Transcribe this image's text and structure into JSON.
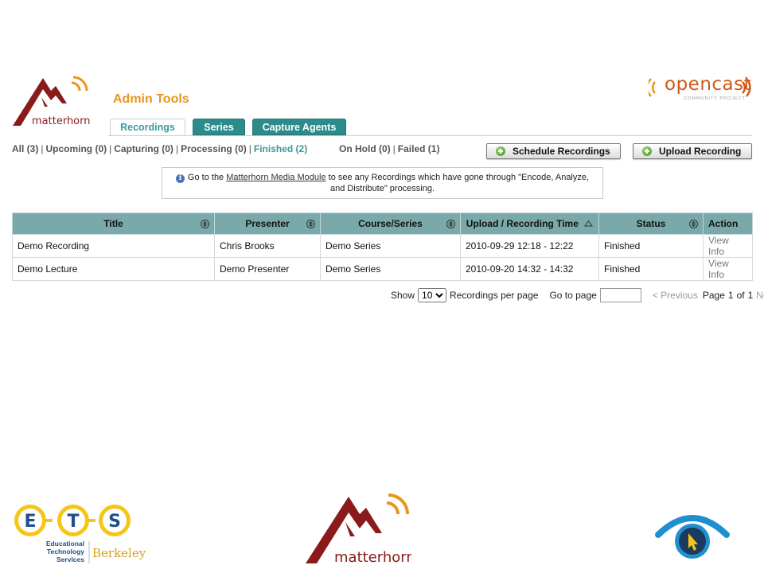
{
  "header": {
    "logo_text": "matterhorn",
    "admin_title": "Admin Tools",
    "opencast_logo": "opencast",
    "opencast_sub": "COMMUNITY PROJECT"
  },
  "tabs": [
    {
      "label": "Recordings",
      "active": true
    },
    {
      "label": "Series",
      "active": false
    },
    {
      "label": "Capture Agents",
      "active": false
    }
  ],
  "filters": [
    {
      "label": "All (3)"
    },
    {
      "label": "Upcoming (0)"
    },
    {
      "label": "Capturing (0)"
    },
    {
      "label": "Processing (0)"
    },
    {
      "label": "Finished (2)",
      "selected": true
    },
    {
      "label": "On Hold (0)"
    },
    {
      "label": "Failed (1)"
    }
  ],
  "buttons": {
    "schedule": "Schedule Recordings",
    "upload": "Upload Recording"
  },
  "info": {
    "prefix": "Go to the",
    "link": "Matterhorn Media Module",
    "suffix": "to see any Recordings which have gone through \"Encode, Analyze, and Distribute\" processing."
  },
  "table": {
    "columns": [
      "Title",
      "Presenter",
      "Course/Series",
      "Upload / Recording Time",
      "Status",
      "Action"
    ],
    "rows": [
      [
        "Demo Recording",
        "Chris Brooks",
        "Demo Series",
        "2010-09-29 12:18 - 12:22",
        "Finished",
        "View Info"
      ],
      [
        "Demo Lecture",
        "Demo Presenter",
        "Demo Series",
        "2010-09-20 14:32 - 14:32",
        "Finished",
        "View Info"
      ]
    ]
  },
  "pager": {
    "show": "Show",
    "per_page_value": "10",
    "per_page_label": "Recordings per page",
    "goto_label": "Go to page",
    "previous": "< Previous",
    "page_word": "Page",
    "current": "1",
    "of_word": "of",
    "total": "1",
    "next": "Next >"
  },
  "footer": {
    "ets_letters": [
      "E",
      "T",
      "S"
    ],
    "ets_line1": "Educational",
    "ets_line2": "Technology",
    "ets_line3": "Services",
    "berkeley": "Berkeley",
    "matterhorn_text": "matterhorn"
  },
  "colors": {
    "accent_orange": "#e8961e",
    "teal_tab": "#2e8b8b",
    "table_header": "#7aa9a9",
    "matterhorn_red": "#8b1a1a",
    "ets_yellow": "#f5c518",
    "ets_blue": "#1f4e8c"
  }
}
